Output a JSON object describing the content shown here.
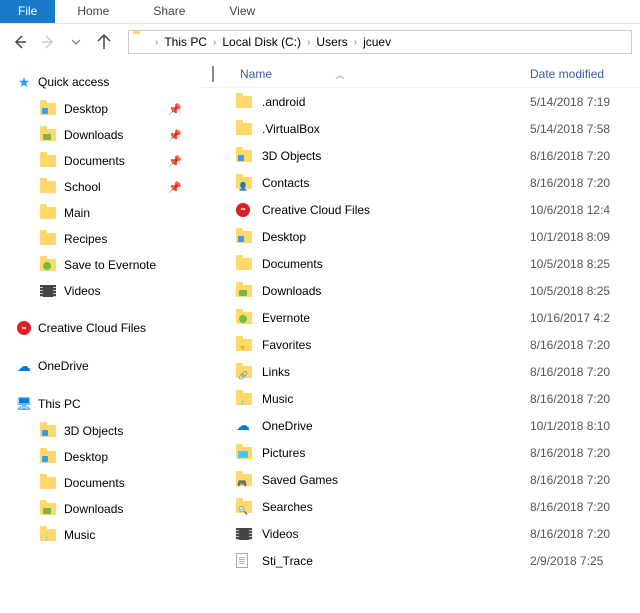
{
  "menubar": {
    "file": "File",
    "tabs": [
      "Home",
      "Share",
      "View"
    ]
  },
  "breadcrumb": {
    "parts": [
      "This PC",
      "Local Disk (C:)",
      "Users",
      "jcuev"
    ]
  },
  "list_header": {
    "name": "Name",
    "date": "Date modified"
  },
  "sidebar": {
    "quick_access": {
      "label": "Quick access",
      "items": [
        {
          "label": "Desktop",
          "pinned": true
        },
        {
          "label": "Downloads",
          "pinned": true
        },
        {
          "label": "Documents",
          "pinned": true
        },
        {
          "label": "School",
          "pinned": true
        },
        {
          "label": "Main",
          "pinned": false
        },
        {
          "label": "Recipes",
          "pinned": false
        },
        {
          "label": "Save to Evernote",
          "pinned": false
        },
        {
          "label": "Videos",
          "pinned": false
        }
      ]
    },
    "creative_cloud": "Creative Cloud Files",
    "onedrive": "OneDrive",
    "this_pc": {
      "label": "This PC",
      "items": [
        "3D Objects",
        "Desktop",
        "Documents",
        "Downloads",
        "Music"
      ]
    }
  },
  "files": [
    {
      "name": ".android",
      "date": "5/14/2018 7:19",
      "icon": "folder"
    },
    {
      "name": ".VirtualBox",
      "date": "5/14/2018 7:58",
      "icon": "folder"
    },
    {
      "name": "3D Objects",
      "date": "8/16/2018 7:20",
      "icon": "folder-3d"
    },
    {
      "name": "Contacts",
      "date": "8/16/2018 7:20",
      "icon": "folder-contacts"
    },
    {
      "name": "Creative Cloud Files",
      "date": "10/6/2018 12:4",
      "icon": "cc"
    },
    {
      "name": "Desktop",
      "date": "10/1/2018 8:09",
      "icon": "folder-desktop"
    },
    {
      "name": "Documents",
      "date": "10/5/2018 8:25",
      "icon": "folder-doc"
    },
    {
      "name": "Downloads",
      "date": "10/5/2018 8:25",
      "icon": "folder-down"
    },
    {
      "name": "Evernote",
      "date": "10/16/2017 4:2",
      "icon": "folder-evernote"
    },
    {
      "name": "Favorites",
      "date": "8/16/2018 7:20",
      "icon": "folder-star"
    },
    {
      "name": "Links",
      "date": "8/16/2018 7:20",
      "icon": "folder-link"
    },
    {
      "name": "Music",
      "date": "8/16/2018 7:20",
      "icon": "folder-music"
    },
    {
      "name": "OneDrive",
      "date": "10/1/2018 8:10",
      "icon": "onedrive"
    },
    {
      "name": "Pictures",
      "date": "8/16/2018 7:20",
      "icon": "folder-picture"
    },
    {
      "name": "Saved Games",
      "date": "8/16/2018 7:20",
      "icon": "folder-games"
    },
    {
      "name": "Searches",
      "date": "8/16/2018 7:20",
      "icon": "folder-search"
    },
    {
      "name": "Videos",
      "date": "8/16/2018 7:20",
      "icon": "folder-video"
    },
    {
      "name": "Sti_Trace",
      "date": "2/9/2018 7:25",
      "icon": "doc"
    }
  ]
}
